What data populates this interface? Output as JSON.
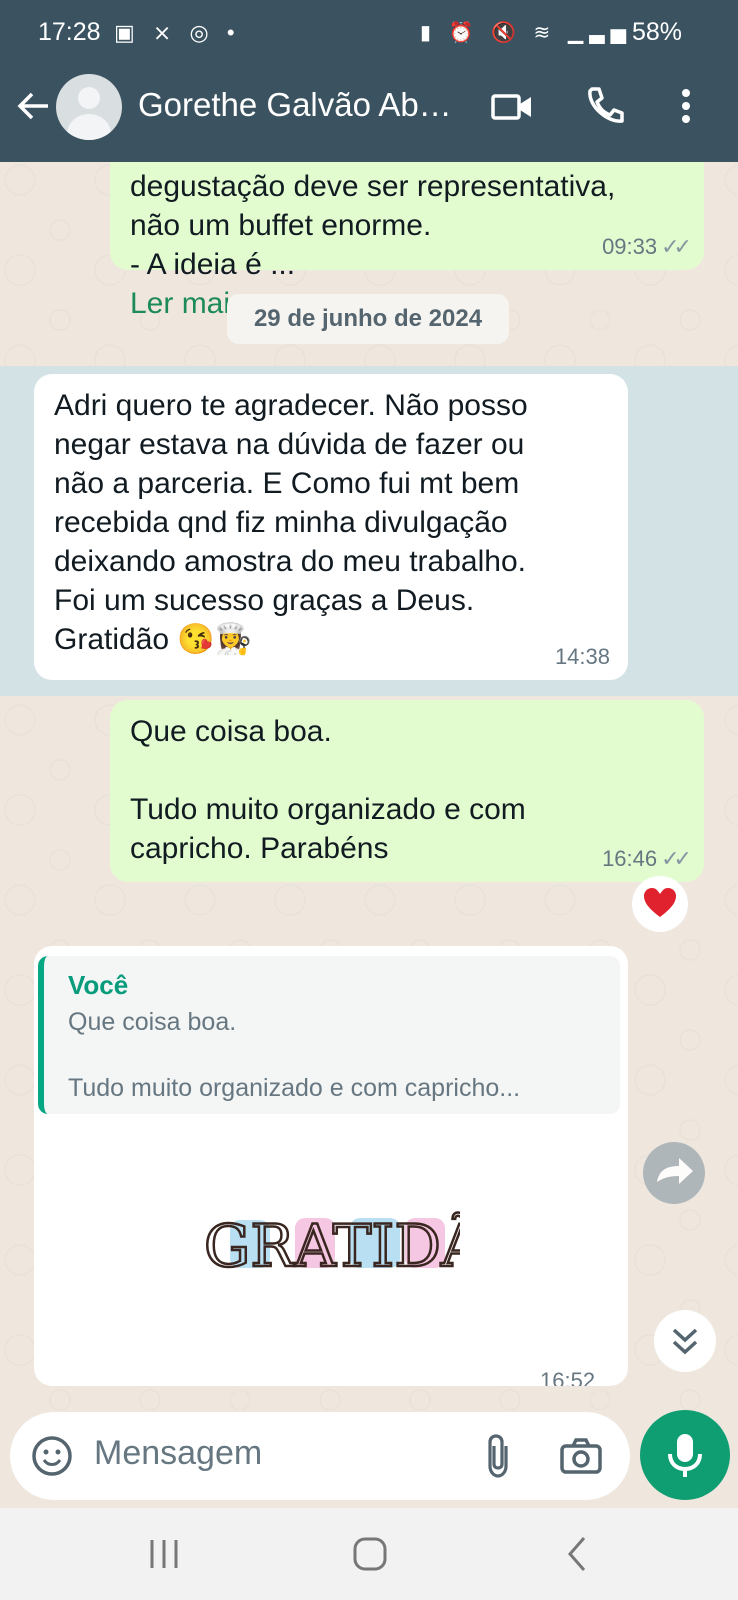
{
  "status_bar": {
    "time": "17:28",
    "left_icons": [
      "gallery-icon",
      "capcut-icon",
      "instagram-icon",
      "dot-icon"
    ],
    "right_icons": [
      "battery-saver-icon",
      "alarm-icon",
      "mute-icon",
      "wifi-icon",
      "signal-icon",
      "volte-icon",
      "signal-icon"
    ],
    "battery": "58%"
  },
  "header": {
    "contact_name": "Gorethe Galvão Ab…",
    "icons": [
      "back-arrow-icon",
      "video-call-icon",
      "phone-icon",
      "more-vert-icon"
    ]
  },
  "messages": [
    {
      "direction": "out",
      "text": "degustação deve ser representativa,\nnão um buffet enorme.\n   - A ideia é ...",
      "read_more": "Ler mais",
      "time": "09:33",
      "status": "read"
    },
    {
      "direction": "date",
      "text": "29 de junho de 2024"
    },
    {
      "direction": "in",
      "text": "Adri quero te agradecer. Não posso\nnegar estava na dúvida de fazer ou\nnão a parceria. E Como fui mt bem\nrecebida qnd fiz minha divulgação\ndeixando amostra do meu trabalho.\nFoi um sucesso graças a Deus.\nGratidão 😘👩‍🍳",
      "time": "14:38"
    },
    {
      "direction": "out",
      "text": "Que coisa boa.\n\nTudo muito organizado e com\ncapricho. Parabéns",
      "time": "16:46",
      "status": "read",
      "reaction": "❤️"
    },
    {
      "direction": "in",
      "quote": {
        "author": "Você",
        "text": "Que coisa boa.\n\nTudo muito organizado e com capricho..."
      },
      "sticker_text": "GRATIDÃO",
      "time": "16:52"
    }
  ],
  "composer": {
    "placeholder": "Mensagem"
  },
  "colors": {
    "header": "#3b5360",
    "outgoing_bubble": "#e2fcd0",
    "incoming_bubble": "#ffffff",
    "accent": "#0f9d72",
    "link": "#1d8a5a"
  }
}
